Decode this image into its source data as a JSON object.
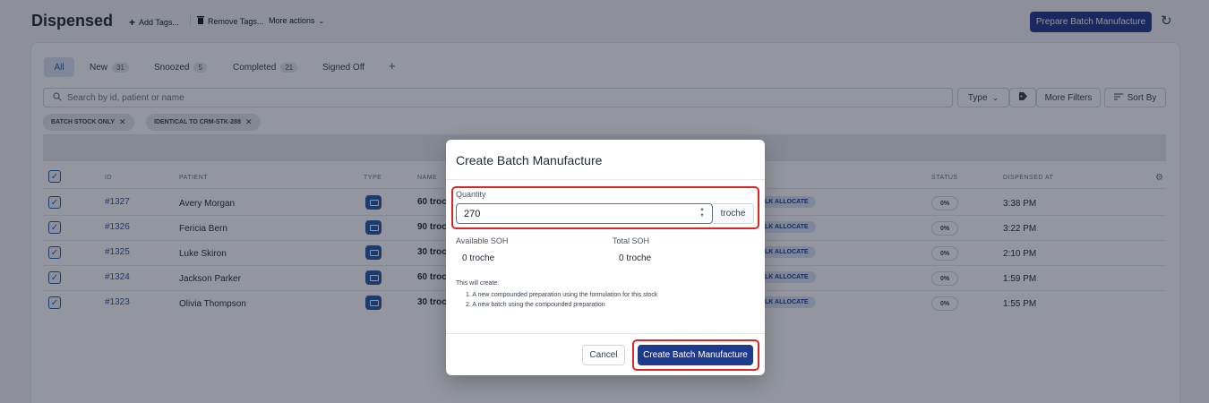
{
  "header": {
    "title": "Dispensed",
    "actions": [
      {
        "label": "Add Tags...",
        "icon": "plus-icon"
      },
      {
        "label": "Remove Tags...",
        "icon": "trash-icon"
      },
      {
        "label": "More actions",
        "icon": "chevron-down-icon"
      }
    ],
    "primary_button": "Prepare Batch Manufacture",
    "refresh_icon": "refresh-icon"
  },
  "tabs": [
    {
      "label": "All",
      "count": ""
    },
    {
      "label": "New",
      "count": "31"
    },
    {
      "label": "Snoozed",
      "count": "5"
    },
    {
      "label": "Completed",
      "count": "21"
    },
    {
      "label": "Signed Off",
      "count": ""
    }
  ],
  "search": {
    "placeholder": "Search by id, patient or name"
  },
  "filters": {
    "type": "Type",
    "more": "More Filters",
    "sort": "Sort By"
  },
  "chips": [
    "BATCH STOCK ONLY",
    "IDENTICAL TO CRM-STK-288"
  ],
  "table": {
    "columns": {
      "id": "ID",
      "patient": "PATIENT",
      "type": "TYPE",
      "name": "NAME",
      "status": "STATUS",
      "dispensed_at": "DISPENSED AT"
    },
    "rows": [
      {
        "id": "#1327",
        "patient": "Avery Morgan",
        "name": "60 troc",
        "tag": "LK ALLOCATE",
        "status": "0%",
        "dispensed_at": "3:38 PM"
      },
      {
        "id": "#1326",
        "patient": "Fericia Bern",
        "name": "90 troc",
        "tag": "LK ALLOCATE",
        "status": "0%",
        "dispensed_at": "3:22 PM"
      },
      {
        "id": "#1325",
        "patient": "Luke Skiron",
        "name": "30 troc",
        "tag": "LK ALLOCATE",
        "status": "0%",
        "dispensed_at": "2:10 PM"
      },
      {
        "id": "#1324",
        "patient": "Jackson Parker",
        "name": "60 troc",
        "tag": "LK ALLOCATE",
        "status": "0%",
        "dispensed_at": "1:59 PM"
      },
      {
        "id": "#1323",
        "patient": "Olivia Thompson",
        "name": "30 troc",
        "tag": "LK ALLOCATE",
        "status": "0%",
        "dispensed_at": "1:55 PM"
      }
    ]
  },
  "modal": {
    "title": "Create Batch Manufacture",
    "quantity_label": "Quantity",
    "quantity_value": "270",
    "quantity_unit": "troche",
    "available_soh_label": "Available SOH",
    "available_soh_value": "0 troche",
    "total_soh_label": "Total SOH",
    "total_soh_value": "0 troche",
    "create_heading": "This will create:",
    "create_items": [
      "1. A new compounded preparation using the formulation for this stock",
      "2. A new batch using the compounded preparation"
    ],
    "cancel": "Cancel",
    "confirm": "Create Batch Manufacture"
  },
  "colors": {
    "primary": "#1e3a8a",
    "highlight": "#dc2626",
    "link": "#2c5aa0"
  }
}
